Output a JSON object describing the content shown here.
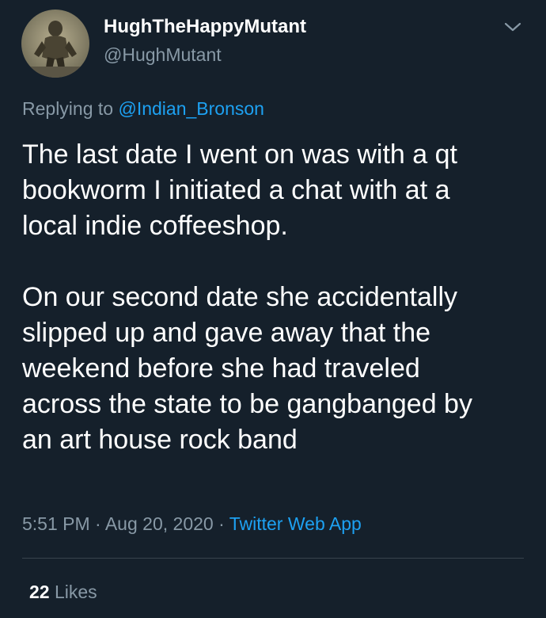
{
  "author": {
    "display_name": "HughTheHappyMutant",
    "handle": "@HughMutant"
  },
  "reply": {
    "prefix": "Replying to",
    "mention": "@Indian_Bronson"
  },
  "tweet": {
    "paragraph_1": "The last date I went on was with a qt\nbookworm I initiated a chat with at a\nlocal indie coffeeshop.",
    "paragraph_2": "On our second date she accidentally\nslipped up and gave away that the\nweekend before she had traveled\nacross the state to be gangbanged by\nan art house rock band"
  },
  "meta": {
    "time": "5:51 PM",
    "separator_1": "·",
    "date": "Aug 20, 2020",
    "separator_2": "·",
    "source": "Twitter Web App"
  },
  "stats": {
    "likes_count": "22",
    "likes_label": "Likes"
  },
  "icons": {
    "caret": "chevron-down-icon",
    "avatar": "avatar"
  },
  "colors": {
    "background": "#15202b",
    "primary_text": "#ffffff",
    "secondary_text": "#8899a6",
    "accent": "#1da1f2",
    "divider": "#38444d"
  }
}
